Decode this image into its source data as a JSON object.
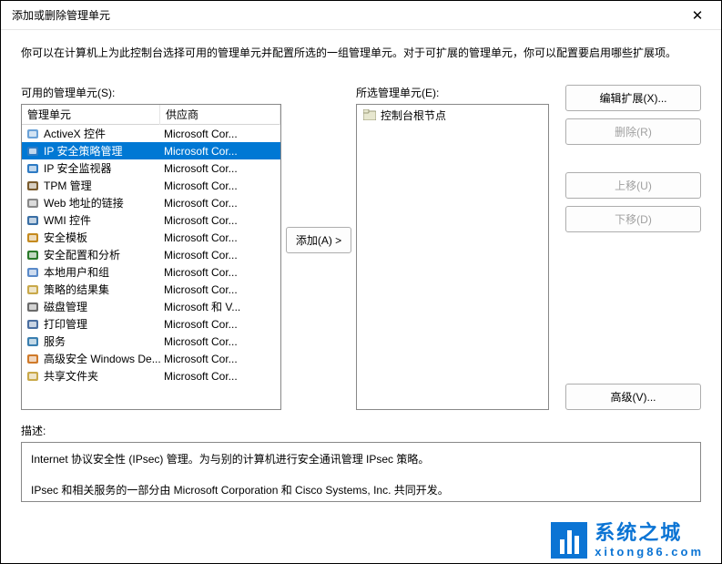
{
  "title": "添加或删除管理单元",
  "intro": "你可以在计算机上为此控制台选择可用的管理单元并配置所选的一组管理单元。对于可扩展的管理单元，你可以配置要启用哪些扩展项。",
  "left": {
    "label": "可用的管理单元(S):",
    "header_col1": "管理单元",
    "header_col2": "供应商",
    "rows": [
      {
        "name": "ActiveX 控件",
        "vendor": "Microsoft Cor...",
        "icon": "window-icon",
        "sel": false
      },
      {
        "name": "IP 安全策略管理",
        "vendor": "Microsoft Cor...",
        "icon": "shield-icon",
        "sel": true
      },
      {
        "name": "IP 安全监视器",
        "vendor": "Microsoft Cor...",
        "icon": "monitor-icon",
        "sel": false
      },
      {
        "name": "TPM 管理",
        "vendor": "Microsoft Cor...",
        "icon": "chip-icon",
        "sel": false
      },
      {
        "name": "Web 地址的链接",
        "vendor": "Microsoft Cor...",
        "icon": "link-icon",
        "sel": false
      },
      {
        "name": "WMI 控件",
        "vendor": "Microsoft Cor...",
        "icon": "gear-icon",
        "sel": false
      },
      {
        "name": "安全模板",
        "vendor": "Microsoft Cor...",
        "icon": "template-icon",
        "sel": false
      },
      {
        "name": "安全配置和分析",
        "vendor": "Microsoft Cor...",
        "icon": "analysis-icon",
        "sel": false
      },
      {
        "name": "本地用户和组",
        "vendor": "Microsoft Cor...",
        "icon": "users-icon",
        "sel": false
      },
      {
        "name": "策略的结果集",
        "vendor": "Microsoft Cor...",
        "icon": "policy-icon",
        "sel": false
      },
      {
        "name": "磁盘管理",
        "vendor": "Microsoft 和 V...",
        "icon": "disk-icon",
        "sel": false
      },
      {
        "name": "打印管理",
        "vendor": "Microsoft Cor...",
        "icon": "printer-icon",
        "sel": false
      },
      {
        "name": "服务",
        "vendor": "Microsoft Cor...",
        "icon": "services-icon",
        "sel": false
      },
      {
        "name": "高级安全 Windows De...",
        "vendor": "Microsoft Cor...",
        "icon": "firewall-icon",
        "sel": false
      },
      {
        "name": "共享文件夹",
        "vendor": "Microsoft Cor...",
        "icon": "share-icon",
        "sel": false
      }
    ]
  },
  "add_btn": "添加(A) >",
  "tree": {
    "label": "所选管理单元(E):",
    "root": "控制台根节点"
  },
  "right_buttons": {
    "edit_ext": "编辑扩展(X)...",
    "remove": "删除(R)",
    "move_up": "上移(U)",
    "move_down": "下移(D)",
    "advanced": "高级(V)..."
  },
  "desc": {
    "label": "描述:",
    "line1": "Internet 协议安全性 (IPsec) 管理。为与别的计算机进行安全通讯管理 IPsec 策略。",
    "line2": "IPsec 和相关服务的一部分由 Microsoft Corporation 和 Cisco Systems, Inc. 共同开发。"
  },
  "watermark": {
    "cn": "系统之城",
    "en": "xitong86.com"
  },
  "icons": {
    "window-icon": "#6aa2d8",
    "shield-icon": "#2e7bc4",
    "monitor-icon": "#2e7bc4",
    "chip-icon": "#7a5b2e",
    "link-icon": "#888",
    "gear-icon": "#3a6fa5",
    "template-icon": "#c58a1e",
    "analysis-icon": "#2a7a2a",
    "users-icon": "#5a8ac9",
    "policy-icon": "#c9a94a",
    "disk-icon": "#6b6b6b",
    "printer-icon": "#4a6ea0",
    "services-icon": "#3a7fb0",
    "firewall-icon": "#d07a2a",
    "share-icon": "#c9a94a",
    "folder-icon": "#d9b96a"
  }
}
